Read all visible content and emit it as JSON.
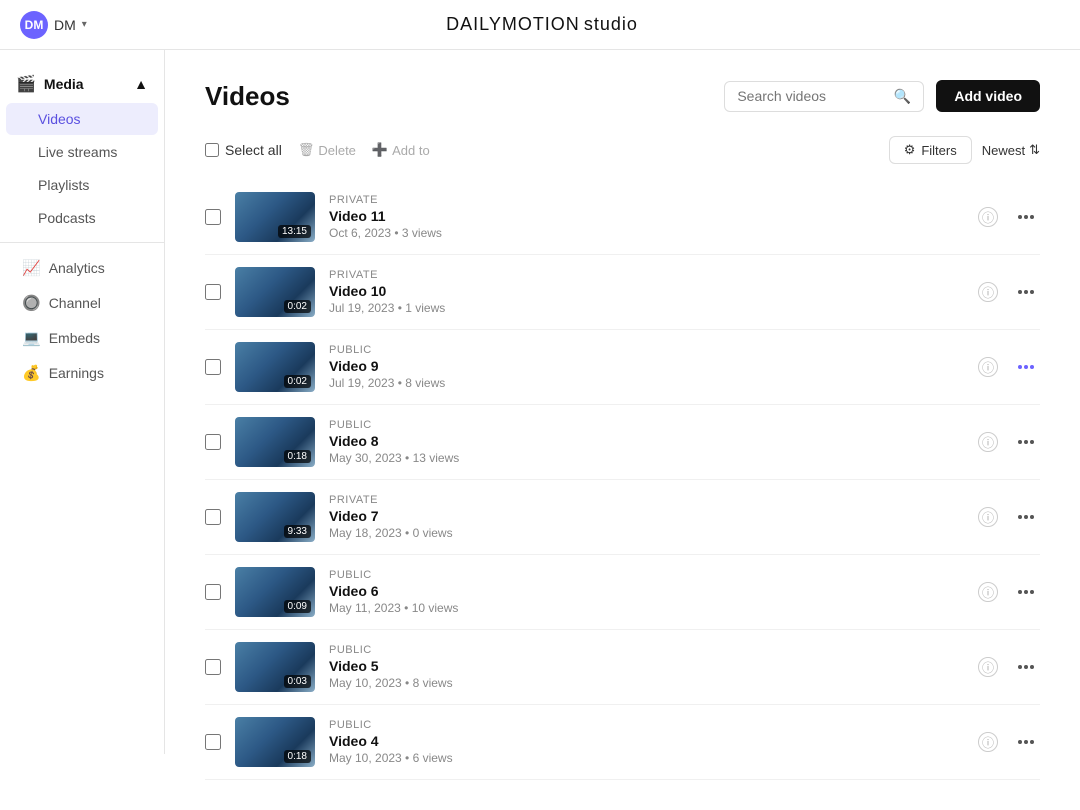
{
  "topbar": {
    "logo_text": "DAILYMOTION",
    "logo_sub": "studio",
    "user": {
      "initials": "DM",
      "name": "DM",
      "chevron": "▾"
    }
  },
  "sidebar": {
    "media_label": "Media",
    "items": [
      {
        "id": "videos",
        "label": "Videos",
        "active": true
      },
      {
        "id": "live-streams",
        "label": "Live streams",
        "active": false
      },
      {
        "id": "playlists",
        "label": "Playlists",
        "active": false
      },
      {
        "id": "podcasts",
        "label": "Podcasts",
        "active": false
      }
    ],
    "nav_items": [
      {
        "id": "analytics",
        "label": "Analytics",
        "icon": "📈"
      },
      {
        "id": "channel",
        "label": "Channel",
        "icon": "🔵"
      },
      {
        "id": "embeds",
        "label": "Embeds",
        "icon": "💻"
      },
      {
        "id": "earnings",
        "label": "Earnings",
        "icon": "💰"
      }
    ]
  },
  "page": {
    "title": "Videos",
    "search_placeholder": "Search videos",
    "add_video_label": "Add video"
  },
  "toolbar": {
    "select_all_label": "Select all",
    "delete_label": "Delete",
    "add_to_label": "Add to",
    "filters_label": "Filters",
    "sort_label": "Newest"
  },
  "videos": [
    {
      "title": "Video 11",
      "visibility": "PRIVATE",
      "date": "Oct 6, 2023",
      "views": "3 views",
      "duration": "13:15"
    },
    {
      "title": "Video 10",
      "visibility": "PRIVATE",
      "date": "Jul 19, 2023",
      "views": "1 views",
      "duration": "0:02"
    },
    {
      "title": "Video 9",
      "visibility": "PUBLIC",
      "date": "Jul 19, 2023",
      "views": "8 views",
      "duration": "0:02",
      "more_active": true
    },
    {
      "title": "Video 8",
      "visibility": "PUBLIC",
      "date": "May 30, 2023",
      "views": "13 views",
      "duration": "0:18"
    },
    {
      "title": "Video 7",
      "visibility": "PRIVATE",
      "date": "May 18, 2023",
      "views": "0 views",
      "duration": "9:33"
    },
    {
      "title": "Video 6",
      "visibility": "PUBLIC",
      "date": "May 11, 2023",
      "views": "10 views",
      "duration": "0:09"
    },
    {
      "title": "Video 5",
      "visibility": "PUBLIC",
      "date": "May 10, 2023",
      "views": "8 views",
      "duration": "0:03"
    },
    {
      "title": "Video 4",
      "visibility": "PUBLIC",
      "date": "May 10, 2023",
      "views": "6 views",
      "duration": "0:18"
    }
  ],
  "colors": {
    "accent": "#6c63ff",
    "active_bg": "#ededfd"
  }
}
